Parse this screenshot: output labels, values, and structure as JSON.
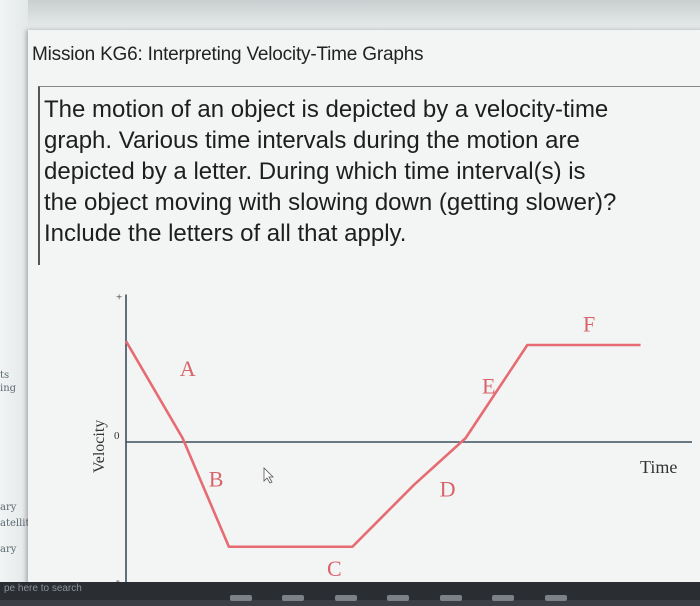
{
  "side_panel": {
    "items": [
      "ts",
      "ing",
      "ary",
      "atellite",
      "ary"
    ]
  },
  "taskbar": {
    "search_hint": "pe here to search"
  },
  "question": {
    "title": "Mission KG6: Interpreting Velocity-Time Graphs",
    "text": "The motion of an object is depicted by a velocity-time\ngraph. Various time intervals during the motion are\ndepicted by a letter. During which time interval(s) is\nthe object moving with slowing down (getting slower)?\nInclude the letters of all that apply."
  },
  "chart_data": {
    "type": "line",
    "xlabel": "Time",
    "ylabel": "Velocity",
    "y_markers": {
      "plus": "+",
      "zero": "0",
      "minus": "-"
    },
    "series": [
      {
        "x": [
          0,
          1.1,
          2,
          4.4,
          5.6,
          6.6,
          7.8,
          10
        ],
        "y": [
          2.6,
          0.1,
          -2.7,
          -2.7,
          -1.1,
          0.1,
          2.5,
          2.5
        ]
      }
    ],
    "xlim": [
      0,
      11
    ],
    "ylim": [
      -3.8,
      3.8
    ],
    "interval_labels": [
      {
        "letter": "A",
        "x": 1.2,
        "y": 1.7
      },
      {
        "letter": "B",
        "x": 1.75,
        "y": -1.15
      },
      {
        "letter": "C",
        "x": 4.05,
        "y": -3.45
      },
      {
        "letter": "D",
        "x": 6.25,
        "y": -1.4
      },
      {
        "letter": "E",
        "x": 7.05,
        "y": 1.25
      },
      {
        "letter": "F",
        "x": 9.0,
        "y": 2.85
      }
    ],
    "colors": {
      "line": "#e66b72",
      "axis": "#3c4f5c",
      "label": "#d9636b"
    }
  }
}
